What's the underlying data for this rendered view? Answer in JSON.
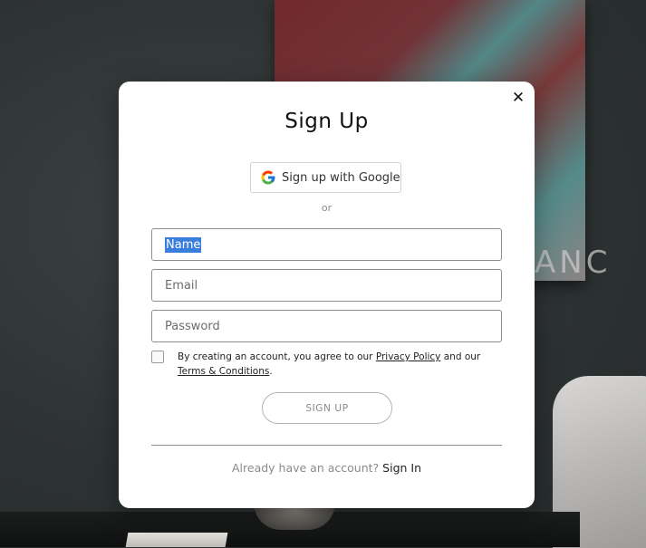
{
  "modal": {
    "title": "Sign Up",
    "close_symbol": "✕",
    "google_button_label": "Sign up with Google",
    "or_text": "or",
    "fields": {
      "name": {
        "value": "Name"
      },
      "email": {
        "placeholder": "Email"
      },
      "password": {
        "placeholder": "Password"
      }
    },
    "terms": {
      "prefix": "By creating an account, you agree to our ",
      "privacy_link": "Privacy Policy",
      "middle": " and our ",
      "terms_link": "Terms & Conditions",
      "suffix": "."
    },
    "signup_button_label": "SIGN UP",
    "signin_prompt": "Already have an account?",
    "signin_link": "Sign In"
  },
  "background": {
    "painting_text": "ANC"
  },
  "colors": {
    "selection": "#3b7ddd",
    "google_blue": "#4285F4",
    "google_red": "#EA4335",
    "google_yellow": "#FBBC05",
    "google_green": "#34A853"
  },
  "icons": {
    "close": "close-icon",
    "google": "google-icon"
  }
}
